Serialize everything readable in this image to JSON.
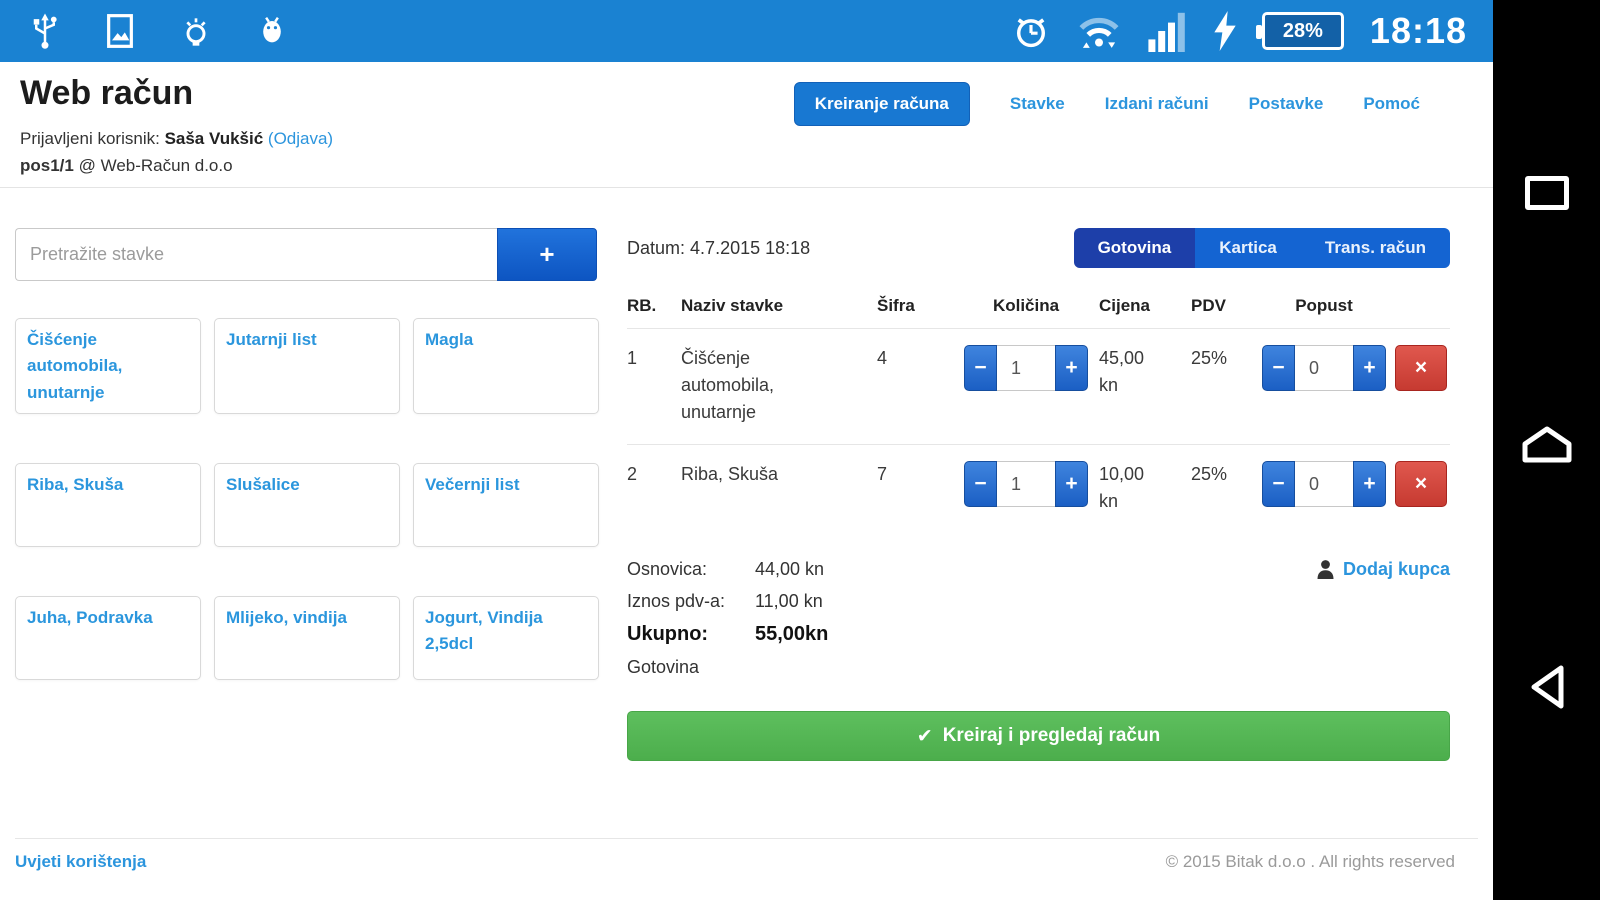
{
  "status_bar": {
    "time": "18:18",
    "battery_percent": "28%",
    "icons_left": [
      "usb",
      "screenshot",
      "bulb",
      "android-debug"
    ],
    "icons_right": [
      "alarm",
      "wifi",
      "signal",
      "charging",
      "battery"
    ]
  },
  "header": {
    "title": "Web račun",
    "login_prefix": "Prijavljeni korisnik:",
    "user_name": "Saša Vukšić",
    "logout_link": "(Odjava)",
    "pos_id": "pos1/1",
    "company": "@ Web-Račun d.o.o"
  },
  "nav": {
    "active_tab": "Kreiranje računa",
    "tabs": [
      "Stavke",
      "Izdani računi",
      "Postavke",
      "Pomoć"
    ]
  },
  "search": {
    "placeholder": "Pretražite stavke"
  },
  "quick_items": [
    "Čišćenje automobila, unutarnje",
    "Jutarnji list",
    "Magla",
    "Riba, Skuša",
    "Slušalice",
    "Večernji list",
    "Juha, Podravka",
    "Mlijeko, vindija",
    "Jogurt, Vindija 2,5dcl"
  ],
  "invoice": {
    "date_label": "Datum:",
    "date_value": "4.7.2015 18:18",
    "payment_methods": {
      "active": "Gotovina",
      "options": [
        "Gotovina",
        "Kartica",
        "Trans. račun"
      ]
    },
    "columns": [
      "RB.",
      "Naziv stavke",
      "Šifra",
      "Količina",
      "Cijena",
      "PDV",
      "Popust"
    ],
    "rows": [
      {
        "rb": "1",
        "name": "Čišćenje automobila, unutarnje",
        "sifra": "4",
        "qty": "1",
        "price": "45,00",
        "currency": "kn",
        "pdv": "25%",
        "popust": "0"
      },
      {
        "rb": "2",
        "name": "Riba, Skuša",
        "sifra": "7",
        "qty": "1",
        "price": "10,00",
        "currency": "kn",
        "pdv": "25%",
        "popust": "0"
      }
    ],
    "totals": {
      "osnovica_label": "Osnovica:",
      "osnovica_value": "44,00 kn",
      "pdv_label": "Iznos pdv-a:",
      "pdv_value": "11,00 kn",
      "ukupno_label": "Ukupno:",
      "ukupno_value": "55,00kn",
      "payment": "Gotovina"
    },
    "add_customer_label": "Dodaj kupca",
    "create_button_label": "Kreiraj i pregledaj račun"
  },
  "glyphs": {
    "plus": "+",
    "minus": "−",
    "delete": "×",
    "check": "✔",
    "add": "+"
  },
  "footer": {
    "terms": "Uvjeti korištenja",
    "copyright": "© 2015 Bitak d.o.o . All rights reserved"
  },
  "colors": {
    "primary_blue": "#1a82d2",
    "active_segment_blue": "#1d3fa9",
    "link_blue": "#2c95dd",
    "action_green": "#4cae4c",
    "delete_red": "#c63a31"
  }
}
